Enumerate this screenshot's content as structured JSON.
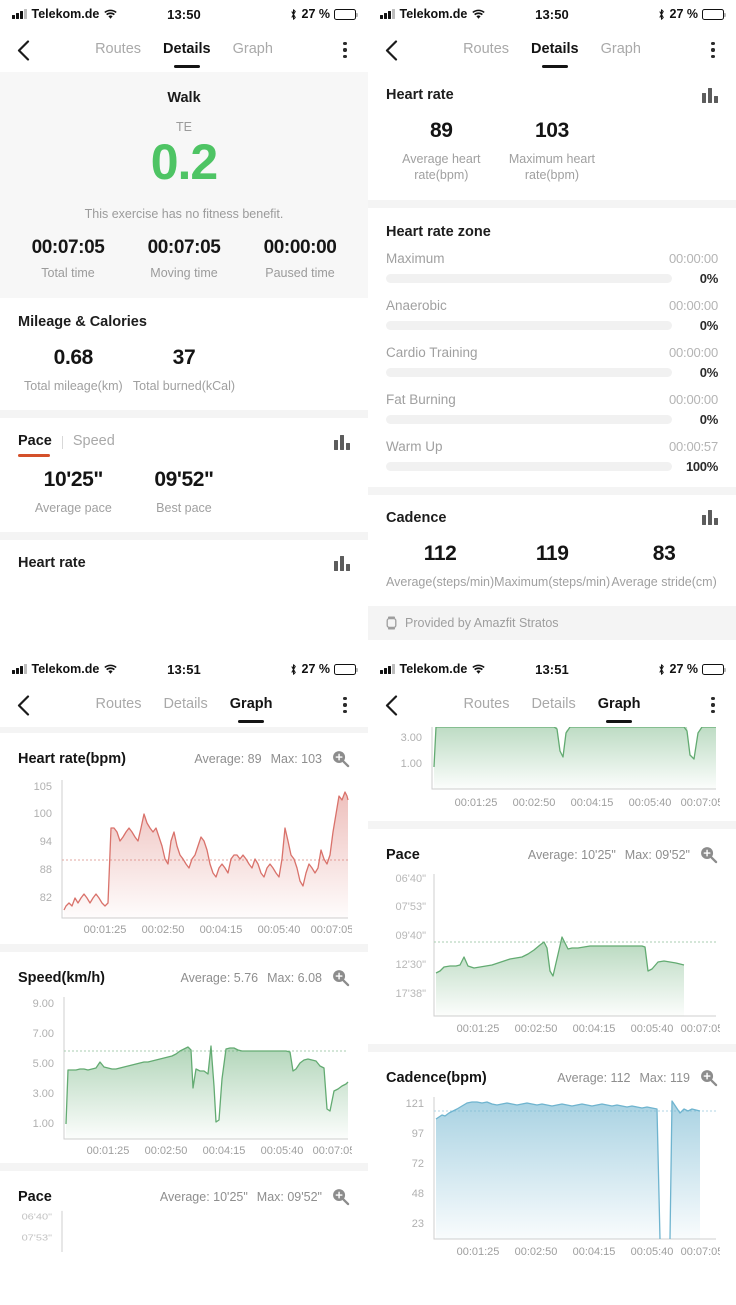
{
  "status_bar": {
    "carrier": "Telekom.de",
    "time_details": "13:50",
    "time_graph": "13:51",
    "battery_pct": "27 %",
    "icons": [
      "signal-bars-icon",
      "wifi-icon",
      "bluetooth-icon",
      "battery-icon"
    ]
  },
  "nav": {
    "back_icon": "chevron-left-icon",
    "menu_icon": "kebab-menu-icon",
    "tabs": [
      {
        "label": "Routes",
        "active": false
      },
      {
        "label": "Details",
        "active": true
      },
      {
        "label": "Graph",
        "active": false
      }
    ],
    "tabs_graph": [
      {
        "label": "Routes",
        "active": false
      },
      {
        "label": "Details",
        "active": false
      },
      {
        "label": "Graph",
        "active": true
      }
    ]
  },
  "details": {
    "sport": "Walk",
    "te_label": "TE",
    "te_value": "0.2",
    "te_color": "#4ec464",
    "note": "This exercise has no fitness benefit.",
    "times": [
      {
        "value": "00:07:05",
        "label": "Total time"
      },
      {
        "value": "00:07:05",
        "label": "Moving time"
      },
      {
        "value": "00:00:00",
        "label": "Paused time"
      }
    ],
    "mileage": {
      "title": "Mileage & Calories",
      "stats": [
        {
          "value": "0.68",
          "label": "Total mileage(km)"
        },
        {
          "value": "37",
          "label": "Total burned(kCal)"
        }
      ]
    },
    "pace": {
      "seg": [
        {
          "label": "Pace",
          "active": true
        },
        {
          "label": "Speed",
          "active": false
        }
      ],
      "accent": "#d4502a",
      "chart_icon": "bar-chart-icon",
      "stats": [
        {
          "value": "10'25\"",
          "label": "Average pace"
        },
        {
          "value": "09'52\"",
          "label": "Best pace"
        }
      ]
    },
    "heart_rate_section_title": "Heart rate",
    "heart_rate": {
      "title": "Heart rate",
      "chart_icon": "bar-chart-icon",
      "stats": [
        {
          "value": "89",
          "label": "Average heart rate(bpm)"
        },
        {
          "value": "103",
          "label": "Maximum heart rate(bpm)"
        }
      ]
    },
    "heart_rate_zone": {
      "title": "Heart rate zone",
      "bar_color": "#5b8def",
      "zones": [
        {
          "name": "Maximum",
          "time": "00:00:00",
          "pct": "0%",
          "fill": 0
        },
        {
          "name": "Anaerobic",
          "time": "00:00:00",
          "pct": "0%",
          "fill": 0
        },
        {
          "name": "Cardio Training",
          "time": "00:00:00",
          "pct": "0%",
          "fill": 0
        },
        {
          "name": "Fat Burning",
          "time": "00:00:00",
          "pct": "0%",
          "fill": 0
        },
        {
          "name": "Warm Up",
          "time": "00:00:57",
          "pct": "100%",
          "fill": 100
        }
      ]
    },
    "cadence": {
      "title": "Cadence",
      "chart_icon": "bar-chart-icon",
      "stats": [
        {
          "value": "112",
          "label": "Average(steps/min)"
        },
        {
          "value": "119",
          "label": "Maximum(steps/min)"
        },
        {
          "value": "83",
          "label": "Average stride(cm)"
        }
      ]
    },
    "provided_by": "Provided by Amazfit Stratos",
    "provided_icon": "watch-icon"
  },
  "graph": {
    "zoom_icon": "zoom-in-icon",
    "avg_prefix": "Average:",
    "max_prefix": "Max:"
  },
  "chart_data": [
    {
      "id": "heart-rate",
      "type": "area",
      "title": "Heart rate(bpm)",
      "average": "89",
      "max": "103",
      "average_label": "Average: 89",
      "max_label": "Max: 103",
      "color": "#d9726b",
      "fill_top": "rgba(217,114,107,0.42)",
      "fill_bottom": "rgba(217,114,107,0.03)",
      "ylabel": "bpm",
      "yticks": [
        "105",
        "100",
        "94",
        "88",
        "82"
      ],
      "ylim": [
        78,
        107
      ],
      "avg_line": 89,
      "xticks": [
        "00:01:25",
        "00:02:50",
        "00:04:15",
        "00:05:40",
        "00:07:05"
      ],
      "values": [
        80,
        81,
        82,
        81,
        83,
        82,
        83,
        84,
        83,
        82,
        83,
        84,
        83,
        82,
        81,
        82,
        97,
        97,
        96,
        94,
        95,
        96,
        97,
        96,
        95,
        94,
        97,
        100,
        98,
        97,
        96,
        97,
        95,
        93,
        90,
        89,
        94,
        96,
        93,
        91,
        90,
        89,
        88,
        90,
        91,
        93,
        95,
        94,
        92,
        89,
        87,
        86,
        88,
        89,
        88,
        87,
        90,
        91,
        91,
        90,
        91,
        90,
        89,
        88,
        90,
        89,
        87,
        86,
        88,
        89,
        88,
        87,
        86,
        90,
        97,
        94,
        91,
        90,
        88,
        85,
        84,
        87,
        89,
        88,
        87,
        88,
        87,
        91,
        89,
        88,
        90,
        95,
        100,
        103,
        102,
        104,
        103,
        102,
        104,
        103,
        104,
        103,
        101,
        100,
        97,
        95,
        92,
        90,
        93,
        92,
        89,
        87,
        86,
        85,
        88,
        89,
        87,
        85,
        84,
        83,
        84,
        85
      ]
    },
    {
      "id": "speed",
      "type": "area",
      "title": "Speed(km/h)",
      "average": "5.76",
      "max": "6.08",
      "average_label": "Average: 5.76",
      "max_label": "Max: 6.08",
      "color": "#63ab72",
      "fill_top": "rgba(99,171,114,0.45)",
      "fill_bottom": "rgba(99,171,114,0.03)",
      "ylabel": "km/h",
      "yticks": [
        "9.00",
        "7.00",
        "5.00",
        "3.00",
        "1.00"
      ],
      "ylim": [
        0,
        9.8
      ],
      "avg_line": 6.08,
      "xticks": [
        "00:01:25",
        "00:02:50",
        "00:04:15",
        "00:05:40",
        "00:07:05"
      ],
      "values": [
        1.4,
        4.8,
        4.8,
        4.8,
        4.85,
        4.85,
        4.8,
        4.85,
        4.9,
        5.3,
        4.95,
        4.9,
        4.85,
        4.85,
        4.9,
        4.95,
        5.0,
        5.05,
        5.1,
        5.15,
        5.2,
        5.2,
        5.25,
        5.3,
        5.35,
        5.4,
        5.45,
        5.5,
        5.6,
        5.8,
        5.95,
        6.05,
        5.9,
        3.4,
        4.8,
        4.7,
        4.7,
        4.5,
        6.4,
        3.5,
        1.6,
        1.7,
        4.0,
        6.0,
        6.05,
        6.05,
        5.95,
        5.9,
        5.9,
        5.9,
        5.9,
        5.9,
        5.9,
        5.9,
        5.9,
        5.9,
        5.9,
        5.9,
        5.9,
        5.9,
        5.9,
        5.9,
        5.85,
        4.6,
        4.7,
        5.1,
        5.3,
        5.35,
        5.3,
        5.25,
        5.2,
        4.9,
        4.8,
        2.0,
        1.9,
        3.2,
        3.3,
        3.5,
        3.6,
        3.8
      ]
    },
    {
      "id": "pace",
      "type": "area",
      "title": "Pace",
      "average": "10'25\"",
      "max": "09'52\"",
      "average_label": "Average: 10'25\"",
      "max_label": "Max: 09'52\"",
      "color": "#63ab72",
      "fill_top": "rgba(99,171,114,0.45)",
      "fill_bottom": "rgba(99,171,114,0.03)",
      "ylabel": "min/km",
      "yticks": [
        "06'40\"",
        "07'53\"",
        "09'40\"",
        "12'30\"",
        "17'38\""
      ],
      "ylim_inverted": true,
      "avg_line_label": "09'40\"",
      "xticks": [
        "00:01:25",
        "00:02:50",
        "00:04:15",
        "00:05:40",
        "00:07:05"
      ],
      "values": [
        12.5,
        12.3,
        12.2,
        12.2,
        12.2,
        11.9,
        12.3,
        12.3,
        12.2,
        12.1,
        12.1,
        12.0,
        11.9,
        11.8,
        11.7,
        11.6,
        11.5,
        11.5,
        11.4,
        11.3,
        11.2,
        11.1,
        10.9,
        10.6,
        10.3,
        10.0,
        9.8,
        12.6,
        12.3,
        11.0,
        9.5,
        9.7,
        10.1,
        10.0,
        9.9,
        9.9,
        9.9,
        9.95,
        10.0,
        10.0,
        10.0,
        10.0,
        10.0,
        10.0,
        10.0,
        10.0,
        10.0,
        10.0,
        9.95,
        12.3,
        12.0,
        11.9,
        11.9,
        12.0,
        12.1,
        12.1
      ]
    },
    {
      "id": "cadence",
      "type": "area",
      "title": "Cadence(bpm)",
      "average": "112",
      "max": "119",
      "average_label": "Average: 112",
      "max_label": "Max: 119",
      "color": "#6fb4cf",
      "fill_top": "rgba(111,180,207,0.55)",
      "fill_bottom": "rgba(111,180,207,0.05)",
      "ylabel": "bpm",
      "yticks": [
        "121",
        "97",
        "72",
        "48",
        "23"
      ],
      "ylim": [
        0,
        128
      ],
      "avg_line": 114,
      "xticks": [
        "00:01:25",
        "00:02:50",
        "00:04:15",
        "00:05:40",
        "00:07:05"
      ],
      "values": [
        108,
        109,
        111,
        110,
        112,
        113,
        114,
        115,
        116,
        118,
        119,
        119,
        118,
        119,
        118,
        117,
        118,
        118,
        117,
        118,
        119,
        118,
        117,
        118,
        117,
        116,
        117,
        118,
        117,
        116,
        115,
        116,
        117,
        118,
        117,
        116,
        117,
        118,
        117,
        116,
        117,
        116,
        115,
        116,
        117,
        116,
        117,
        118,
        117,
        116,
        117,
        116,
        115,
        116,
        117,
        116,
        115,
        116,
        117,
        116,
        115,
        116,
        115,
        114,
        115,
        114,
        113,
        0,
        0,
        0,
        0,
        119,
        112,
        113,
        114,
        113,
        114,
        115
      ]
    }
  ]
}
